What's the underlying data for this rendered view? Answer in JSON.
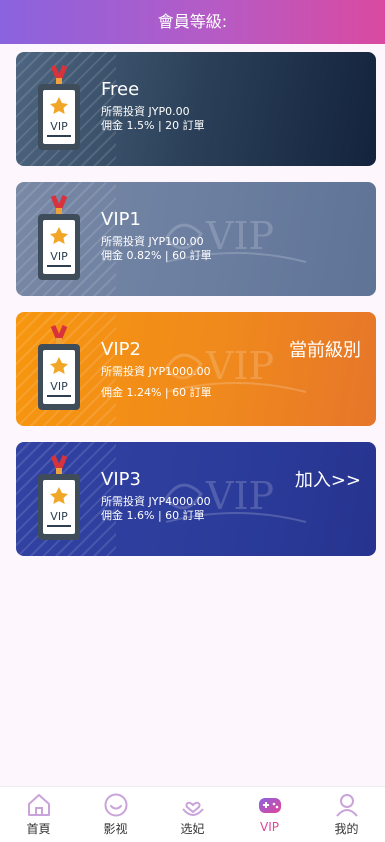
{
  "header": {
    "title": "會員等級:"
  },
  "levels": [
    {
      "name": "Free",
      "required": "所需投資 JYP0.00",
      "commission": "佣金 1.5% | 20 訂單",
      "action": ""
    },
    {
      "name": "VIP1",
      "required": "所需投資 JYP100.00",
      "commission": "佣金 0.82% | 60 訂單",
      "action": ""
    },
    {
      "name": "VIP2",
      "required": "所需投資 JYP1000.00",
      "commission": "佣金 1.24% | 60 訂單",
      "action": "當前級別"
    },
    {
      "name": "VIP3",
      "required": "所需投資 JYP4000.00",
      "commission": "佣金 1.6% | 60 訂單",
      "action": "加入>>"
    }
  ],
  "badge_text": "VIP",
  "watermark_text": "VIP",
  "nav": [
    {
      "label": "首頁",
      "icon": "home-icon"
    },
    {
      "label": "影视",
      "icon": "smile-icon"
    },
    {
      "label": "选妃",
      "icon": "heart-hand-icon"
    },
    {
      "label": "VIP",
      "icon": "gamepad-icon",
      "active": true
    },
    {
      "label": "我的",
      "icon": "user-icon"
    }
  ],
  "colors": {
    "header_start": "#8a63de",
    "header_end": "#da4aa0",
    "free_card": "#1f3550",
    "vip1_card": "#6a7f9f",
    "vip2_card": "#f0891a",
    "vip3_card": "#2b3a98",
    "active_nav": "#e0459a"
  }
}
